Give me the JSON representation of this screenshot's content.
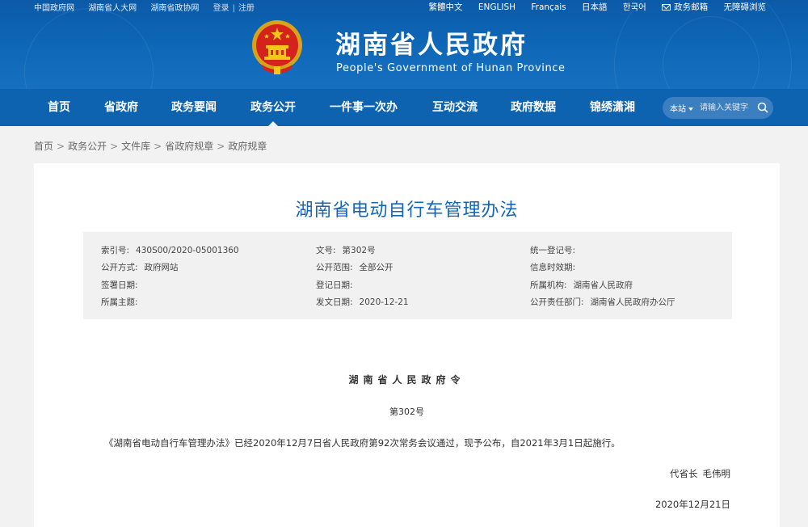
{
  "top_links_left": [
    "中国政府网",
    "湖南省人大网",
    "湖南省政协网"
  ],
  "account": {
    "login": "登录",
    "separator": "|",
    "register": "注册"
  },
  "top_links_right": {
    "traditional": "繁體中文",
    "english": "ENGLISH",
    "french": "Français",
    "japanese": "日本語",
    "korean": "한국어",
    "mail": "政务邮箱",
    "accessibility": "无障碍浏览"
  },
  "site": {
    "title": "湖南省人民政府",
    "subtitle": "People's Government of Hunan Province"
  },
  "nav": {
    "items": [
      {
        "label": "首页"
      },
      {
        "label": "省政府"
      },
      {
        "label": "政务要闻"
      },
      {
        "label": "政务公开",
        "active": true
      },
      {
        "label": "一件事一次办"
      },
      {
        "label": "互动交流"
      },
      {
        "label": "政府数据"
      },
      {
        "label": "锦绣潇湘"
      }
    ]
  },
  "search": {
    "scope": "本站",
    "placeholder": "请输入关键字"
  },
  "breadcrumb": [
    "首页",
    "政务公开",
    "文件库",
    "省政府规章",
    "政府规章"
  ],
  "document": {
    "title": "湖南省电动自行车管理办法",
    "meta": {
      "index_label": "索引号:",
      "index_value": "430S00/2020-05001360",
      "doc_no_label": "文号:",
      "doc_no_value": "第302号",
      "unified_label": "统一登记号:",
      "unified_value": "",
      "open_method_label": "公开方式:",
      "open_method_value": "政府网站",
      "open_scope_label": "公开范围:",
      "open_scope_value": "全部公开",
      "validity_label": "信息时效期:",
      "validity_value": "",
      "signed_label": "签署日期:",
      "signed_value": "",
      "registered_label": "登记日期:",
      "registered_value": "",
      "org_label": "所属机构:",
      "org_value": "湖南省人民政府",
      "topic_label": "所属主题:",
      "topic_value": "",
      "issued_label": "发文日期:",
      "issued_value": "2020-12-21",
      "responsible_label": "公开责任部门:",
      "responsible_value": "湖南省人民政府办公厅"
    },
    "decree_heading": "湖南省人民政府令",
    "decree_number": "第302号",
    "body": "《湖南省电动自行车管理办法》已经2020年12月7日省人民政府第92次常务会议通过，现予公布，自2021年3月1日起施行。",
    "signer_role": "代省长",
    "signer_name": "毛伟明",
    "date": "2020年12月21日"
  },
  "colors": {
    "banner": "#0f68b8",
    "nav": "#0d63b0",
    "title": "#1566b5",
    "page_bg": "#f2f2f2"
  },
  "icons": [
    "national-emblem-icon",
    "mail-icon",
    "search-icon",
    "caret-down-icon"
  ]
}
